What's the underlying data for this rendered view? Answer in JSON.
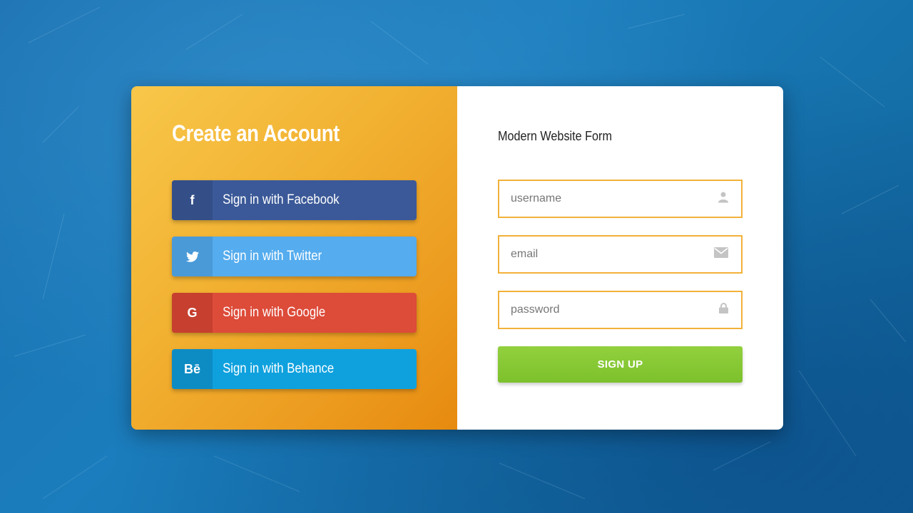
{
  "left_panel": {
    "title": "Create an Account",
    "buttons": [
      {
        "icon": "facebook-icon",
        "icon_text": "f",
        "label": "Sign in with Facebook",
        "color": "#3b5998"
      },
      {
        "icon": "twitter-icon",
        "icon_text": "",
        "label": "Sign in with Twitter",
        "color": "#55acee"
      },
      {
        "icon": "google-icon",
        "icon_text": "G",
        "label": "Sign in with Google",
        "color": "#dd4b39"
      },
      {
        "icon": "behance-icon",
        "icon_text": "Bē",
        "label": "Sign in with Behance",
        "color": "#0fa1de"
      }
    ],
    "gradient": [
      "#f8c74a",
      "#e68a0f"
    ]
  },
  "right_panel": {
    "title": "Modern Website Form",
    "fields": [
      {
        "placeholder": "username",
        "value": "",
        "icon": "user-icon"
      },
      {
        "placeholder": "email",
        "value": "",
        "icon": "envelope-icon"
      },
      {
        "placeholder": "password",
        "value": "",
        "icon": "lock-icon"
      }
    ],
    "submit_label": "SIGN UP",
    "accent": "#f2b13a",
    "submit_color": "#7cc12c"
  },
  "background_color": "#1a6fae"
}
